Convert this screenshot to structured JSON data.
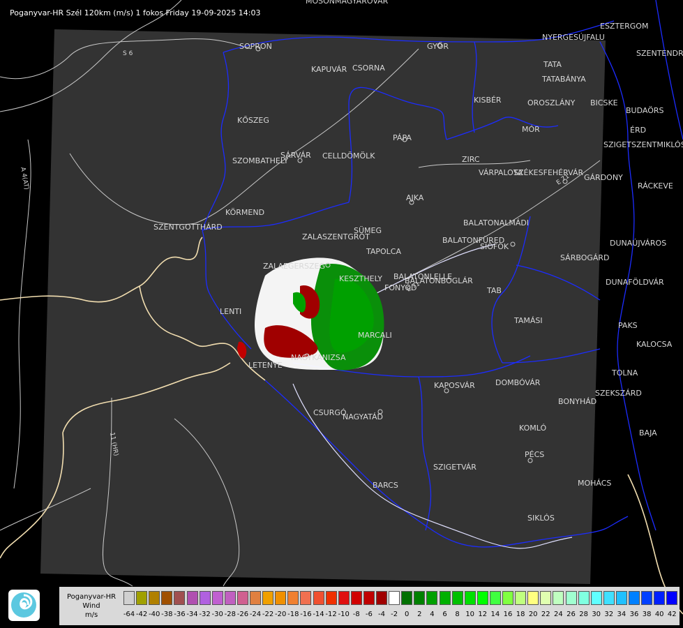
{
  "title": "Poganyvar-HR Szél 120km (m/s) 1 fokos Friday 19-09-2025 14:03",
  "legend": {
    "line1": "Poganyvar-HR",
    "line2": "Wind",
    "line3": "m/s",
    "values": [
      "-64",
      "-42",
      "-40",
      "-38",
      "-36",
      "-34",
      "-32",
      "-30",
      "-28",
      "-26",
      "-24",
      "-22",
      "-20",
      "-18",
      "-16",
      "-14",
      "-12",
      "-10",
      "-8",
      "-6",
      "-4",
      "-2",
      "0",
      "2",
      "4",
      "6",
      "8",
      "10",
      "12",
      "14",
      "16",
      "18",
      "20",
      "22",
      "24",
      "26",
      "28",
      "30",
      "32",
      "34",
      "36",
      "38",
      "40",
      "42"
    ],
    "colors": [
      "#d0d0d0",
      "#a0a000",
      "#b08000",
      "#a05000",
      "#a05050",
      "#b050b0",
      "#b060e0",
      "#c060d0",
      "#c060c0",
      "#d06090",
      "#e08040",
      "#f0a000",
      "#f09000",
      "#f08030",
      "#f07050",
      "#f05030",
      "#f03000",
      "#e01010",
      "#d00000",
      "#c00000",
      "#a00000",
      "#ffffff",
      "#007000",
      "#008000",
      "#00a000",
      "#00b000",
      "#00c000",
      "#00e000",
      "#00ff00",
      "#40ff40",
      "#80ff40",
      "#c0ff80",
      "#ffff80",
      "#e0ffb0",
      "#c0ffc0",
      "#a0ffd0",
      "#80ffe0",
      "#60ffff",
      "#40e0ff",
      "#20c0ff",
      "#0080ff",
      "#0040ff",
      "#0020ff",
      "#0000ff"
    ]
  },
  "cities": [
    {
      "name": "MOSONMAGYARÓVÁR"
    },
    {
      "name": "SOPRON"
    },
    {
      "name": "GYŐR"
    },
    {
      "name": "KAPUVÁR"
    },
    {
      "name": "CSORNA"
    },
    {
      "name": "ESZTERGOM"
    },
    {
      "name": "NYERGESÚJFALU"
    },
    {
      "name": "SZENTENDRE"
    },
    {
      "name": "TATA"
    },
    {
      "name": "TATABÁNYA"
    },
    {
      "name": "KISBÉR"
    },
    {
      "name": "OROSZLÁNY"
    },
    {
      "name": "BICSKE"
    },
    {
      "name": "BUDAÖRS"
    },
    {
      "name": "MÓR"
    },
    {
      "name": "ÉRD"
    },
    {
      "name": "SZIGETSZENTMIKLÓS"
    },
    {
      "name": "KŐSZEG"
    },
    {
      "name": "PÁPA"
    },
    {
      "name": "SZOMBATHELY"
    },
    {
      "name": "SÁRVÁR"
    },
    {
      "name": "CELLDÖMÖLK"
    },
    {
      "name": "ZIRC"
    },
    {
      "name": "VÁRPALOTA"
    },
    {
      "name": "SZÉKESFEHÉRVÁR"
    },
    {
      "name": "GÁRDONY"
    },
    {
      "name": "RÁCKEVE"
    },
    {
      "name": "AJKA"
    },
    {
      "name": "KÖRMEND"
    },
    {
      "name": "SZENTGOTTHÁRD"
    },
    {
      "name": "SÜMEG"
    },
    {
      "name": "BALATONALMÁDI"
    },
    {
      "name": "ZALASZENTGRÓT"
    },
    {
      "name": "BALATONFÜRED"
    },
    {
      "name": "SIÓFOK"
    },
    {
      "name": "TAPOLCA"
    },
    {
      "name": "DUNAÚJVÁROS"
    },
    {
      "name": "ZALAEGERSZEG"
    },
    {
      "name": "SÁRBOGÁRD"
    },
    {
      "name": "KESZTHELY"
    },
    {
      "name": "BALATONLELLE"
    },
    {
      "name": "FONYÓD"
    },
    {
      "name": "BALATONBOGLÁR"
    },
    {
      "name": "DUNAFÖLDVÁR"
    },
    {
      "name": "TAB"
    },
    {
      "name": "LENTI"
    },
    {
      "name": "TAMÁSI"
    },
    {
      "name": "PAKS"
    },
    {
      "name": "MARCALI"
    },
    {
      "name": "KALOCSA"
    },
    {
      "name": "LETENYE"
    },
    {
      "name": "NAGYKANIZSA"
    },
    {
      "name": "TOLNA"
    },
    {
      "name": "KAPOSVÁR"
    },
    {
      "name": "DOMBÓVÁR"
    },
    {
      "name": "SZEKSZÁRD"
    },
    {
      "name": "BONYHÁD"
    },
    {
      "name": "CSURGÓ"
    },
    {
      "name": "NAGYATÁD"
    },
    {
      "name": "KOMLÓ"
    },
    {
      "name": "BAJA"
    },
    {
      "name": "PÉCS"
    },
    {
      "name": "SZIGETVÁR"
    },
    {
      "name": "MOHÁCS"
    },
    {
      "name": "BARCS"
    },
    {
      "name": "SIKLÓS"
    }
  ],
  "roads": [
    "S 6",
    "A 4(AT)",
    "11 (HR)",
    "E 71",
    "E 71"
  ]
}
